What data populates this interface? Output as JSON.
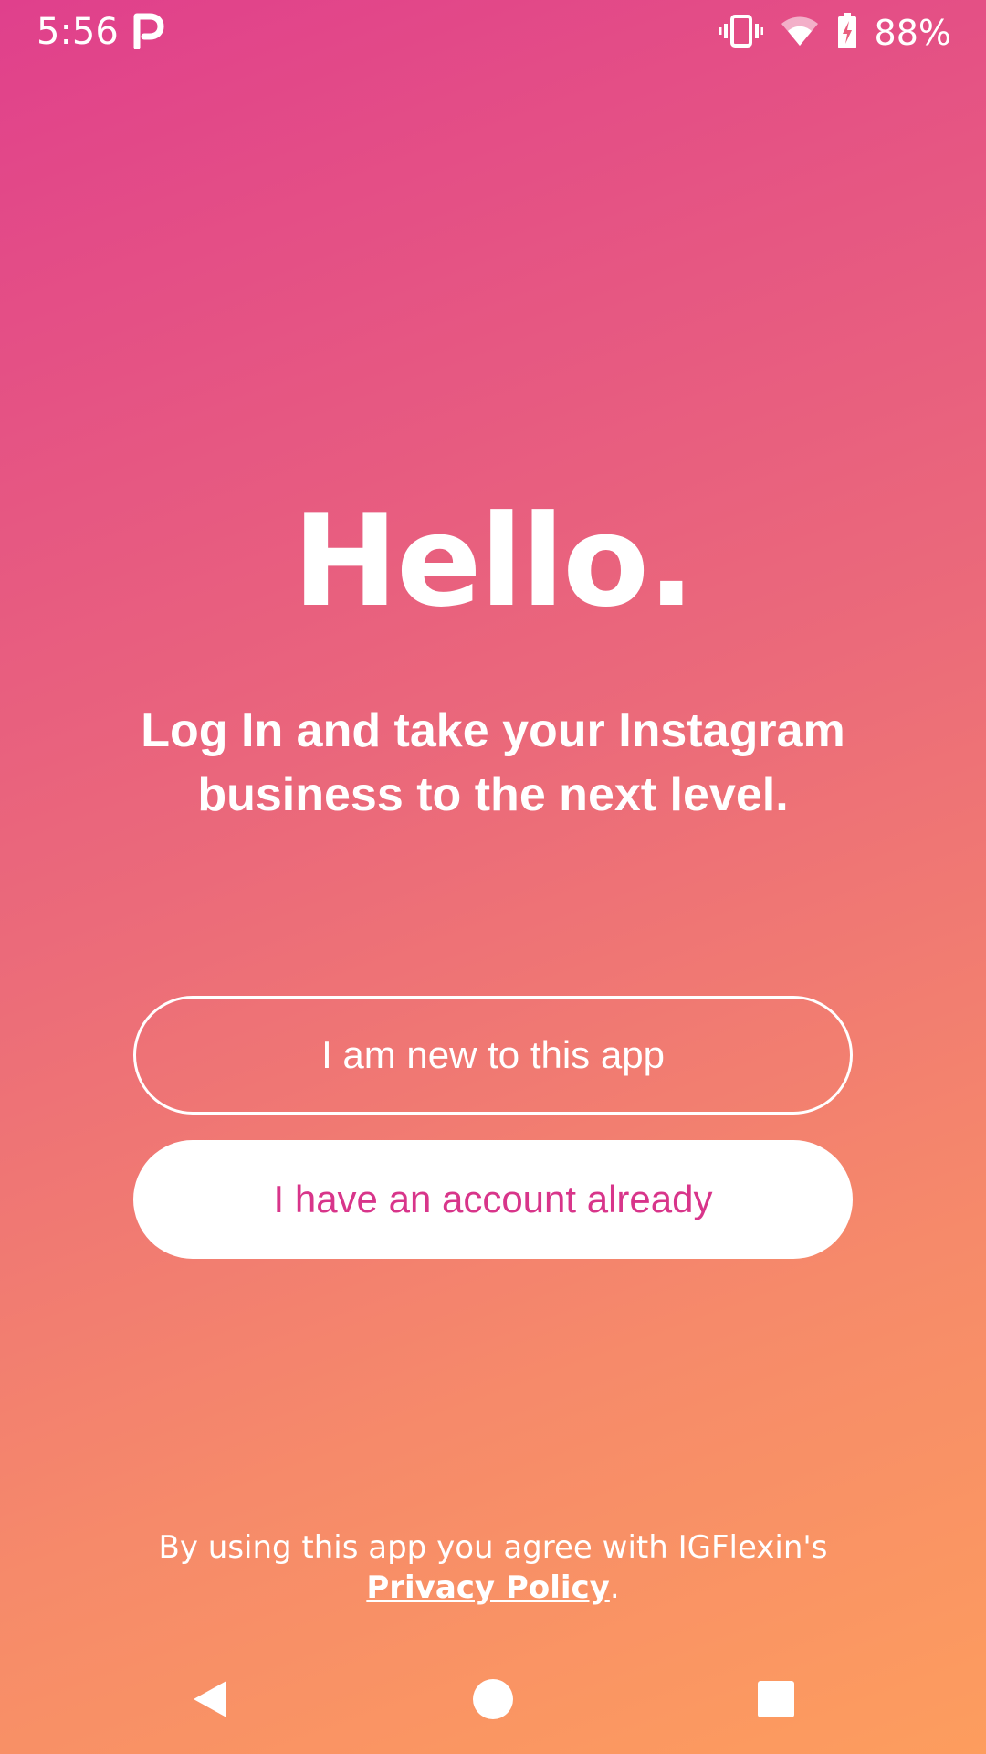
{
  "status_bar": {
    "time": "5:56",
    "battery": "88%",
    "icons": [
      "parking-app-icon",
      "vibrate-icon",
      "wifi-icon",
      "battery-charging-icon"
    ]
  },
  "main": {
    "greeting": "Hello.",
    "subtitle": "Log In and take your Instagram business to the next level.",
    "new_user_button": "I am new to this app",
    "existing_account_button": "I have an account already"
  },
  "legal": {
    "text": "By using this app you agree with IGFlexin's",
    "link": "Privacy Policy",
    "suffix": "."
  },
  "nav_bar": {
    "icons": [
      "back-icon",
      "home-icon",
      "recents-icon"
    ]
  },
  "colors": {
    "gradient_start": "#e0408c",
    "gradient_end": "#fd9d5e",
    "accent_text": "#d8358a",
    "white": "#ffffff"
  }
}
